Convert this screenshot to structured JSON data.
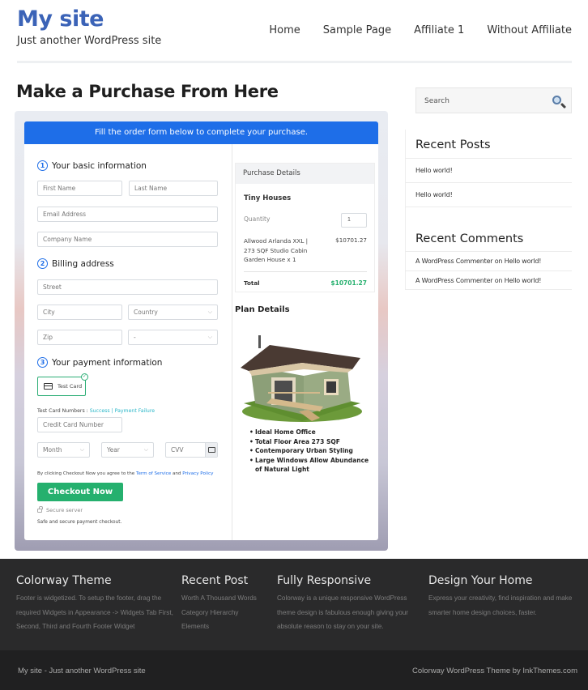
{
  "header": {
    "site_title": "My site",
    "tagline": "Just another WordPress site",
    "nav": [
      {
        "label": "Home"
      },
      {
        "label": "Sample Page"
      },
      {
        "label": "Affiliate 1"
      },
      {
        "label": "Without Affiliate"
      }
    ]
  },
  "main": {
    "page_title": "Make a Purchase From Here",
    "form": {
      "banner": "Fill the order form below to complete your purchase.",
      "step1": {
        "num": "1",
        "title": "Your basic information"
      },
      "step2": {
        "num": "2",
        "title": "Billing address"
      },
      "step3": {
        "num": "3",
        "title": "Your payment information"
      },
      "placeholders": {
        "first_name": "First Name",
        "last_name": "Last Name",
        "email": "Email Address",
        "company": "Company Name",
        "street": "Street",
        "city": "City",
        "country": "Country",
        "zip": "Zip",
        "state": "-",
        "card_number": "Credit Card Number",
        "month": "Month",
        "year": "Year",
        "cvv": "CVV"
      },
      "payment_method": "Test Card",
      "test_numbers_label": "Test Card Numbers : ",
      "success_link": "Success",
      "separator": " | ",
      "failure_link": "Payment Failure",
      "agree_prefix": "By clicking Checkout Now you agree to the ",
      "terms_link": "Term of Service",
      "agree_and": " and ",
      "privacy_link": "Privacy Policy",
      "checkout_button": "Checkout Now",
      "secure_server": "Secure server",
      "safe_text": "Safe and secure payment checkout."
    },
    "purchase_details": {
      "heading": "Purchase Details",
      "product": "Tiny Houses",
      "quantity_label": "Quantity",
      "quantity": "1",
      "item_name": "Allwood Arlanda XXL | 273 SQF Studio Cabin Garden House x 1",
      "item_price": "$10701.27",
      "total_label": "Total",
      "total": "$10701.27"
    },
    "plan": {
      "title": "Plan Details",
      "features": [
        "Ideal Home Office",
        "Total Floor Area 273 SQF",
        "Contemporary Urban Styling",
        "Large Windows Allow Abundance of Natural Light"
      ]
    }
  },
  "sidebar": {
    "search_placeholder": "Search",
    "recent_posts_title": "Recent Posts",
    "recent_posts": [
      "Hello world!",
      "Hello world!"
    ],
    "recent_comments_title": "Recent Comments",
    "recent_comments": [
      "A WordPress Commenter on Hello world!",
      "A WordPress Commenter on Hello world!"
    ]
  },
  "footer": {
    "cols": [
      {
        "title": "Colorway Theme",
        "text": "Footer is widgetized. To setup the footer, drag the required Widgets in Appearance -> Widgets Tab First, Second, Third and Fourth Footer Widget"
      },
      {
        "title": "Recent Post",
        "links": [
          "Worth A Thousand Words",
          "Category Hierarchy",
          "Elements"
        ]
      },
      {
        "title": "Fully Responsive",
        "text": "Colorway is a unique responsive WordPress theme design is fabulous enough giving your absolute reason to stay on your site."
      },
      {
        "title": "Design Your Home",
        "text": "Express your creativity, find inspiration and make smarter home design choices, faster."
      }
    ],
    "bottom_left": "My site - Just another WordPress site",
    "bottom_right": "Colorway WordPress Theme by InkThemes.com"
  },
  "colors": {
    "brand": "#3b63b7",
    "banner": "#1e6ee8",
    "checkout": "#25b06e",
    "footer_bg": "#2a2a2b"
  }
}
